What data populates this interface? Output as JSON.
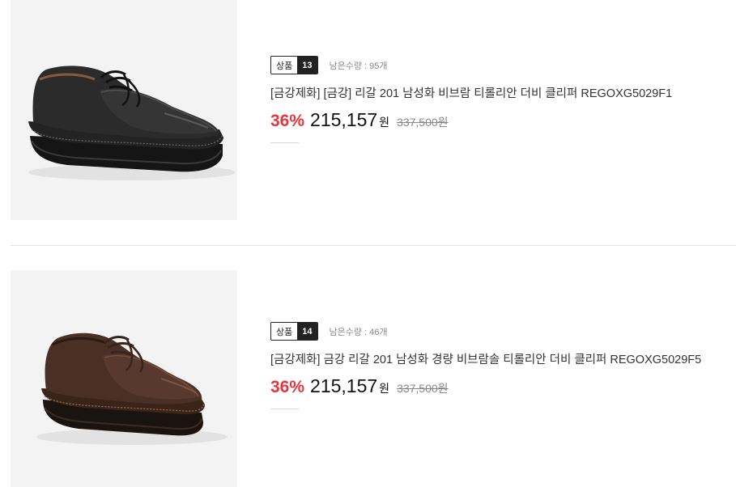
{
  "products": [
    {
      "badge_label": "상품",
      "badge_number": "13",
      "stock_label": "남은수량 : ",
      "stock_value": "95개",
      "title": "[금강제화] [금강] 리갈 201 남성화 비브람 티롤리안 더비 클리퍼 REGOXG5029F1",
      "discount": "36%",
      "price": "215,157",
      "price_unit": "원",
      "original_price": "337,500원",
      "shoe_color": "#2b2b2b",
      "image_icon": "black-derby-shoe-image"
    },
    {
      "badge_label": "상품",
      "badge_number": "14",
      "stock_label": "남은수량 : ",
      "stock_value": "46개",
      "title": "[금강제화] 금강 리갈 201 남성화 경량 비브람솔 티롤리안 더비 클리퍼 REGOXG5029F5",
      "discount": "36%",
      "price": "215,157",
      "price_unit": "원",
      "original_price": "337,500원",
      "shoe_color": "#4a2f24",
      "image_icon": "brown-derby-shoe-image"
    }
  ],
  "colors": {
    "discount": "#e8343c",
    "badge_dark": "#222222",
    "thumb_bg": "#f3f3f3"
  }
}
